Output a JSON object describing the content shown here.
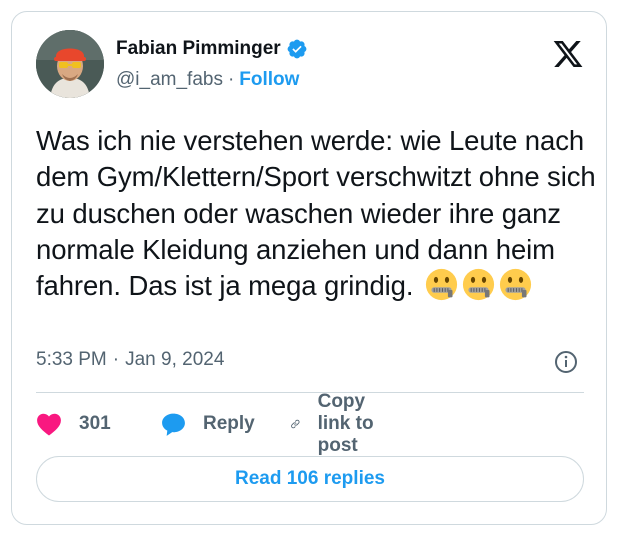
{
  "author": {
    "name": "Fabian Pimminger",
    "handle": "@i_am_fabs",
    "separator": "·",
    "follow_label": "Follow",
    "verified": true
  },
  "tweet": {
    "text": "Was ich nie verstehen werde: wie Leute nach dem Gym/Klettern/Sport verschwitzt ohne sich zu duschen oder waschen wieder ihre ganz normale Kleidung anziehen und dann heim fahren. Das ist ja mega grindig.",
    "emojis": [
      "zipper-mouth-face",
      "zipper-mouth-face",
      "zipper-mouth-face"
    ],
    "time": "5:33 PM",
    "meta_separator": "·",
    "date": "Jan 9, 2024"
  },
  "actions": {
    "like_count": "301",
    "reply_label": "Reply",
    "copy_link_label": "Copy link to post"
  },
  "read_replies_label": "Read 106 replies",
  "colors": {
    "accent": "#1d9bf0",
    "like": "#f91880",
    "secondary_text": "#536471",
    "border": "#cfd9de"
  }
}
